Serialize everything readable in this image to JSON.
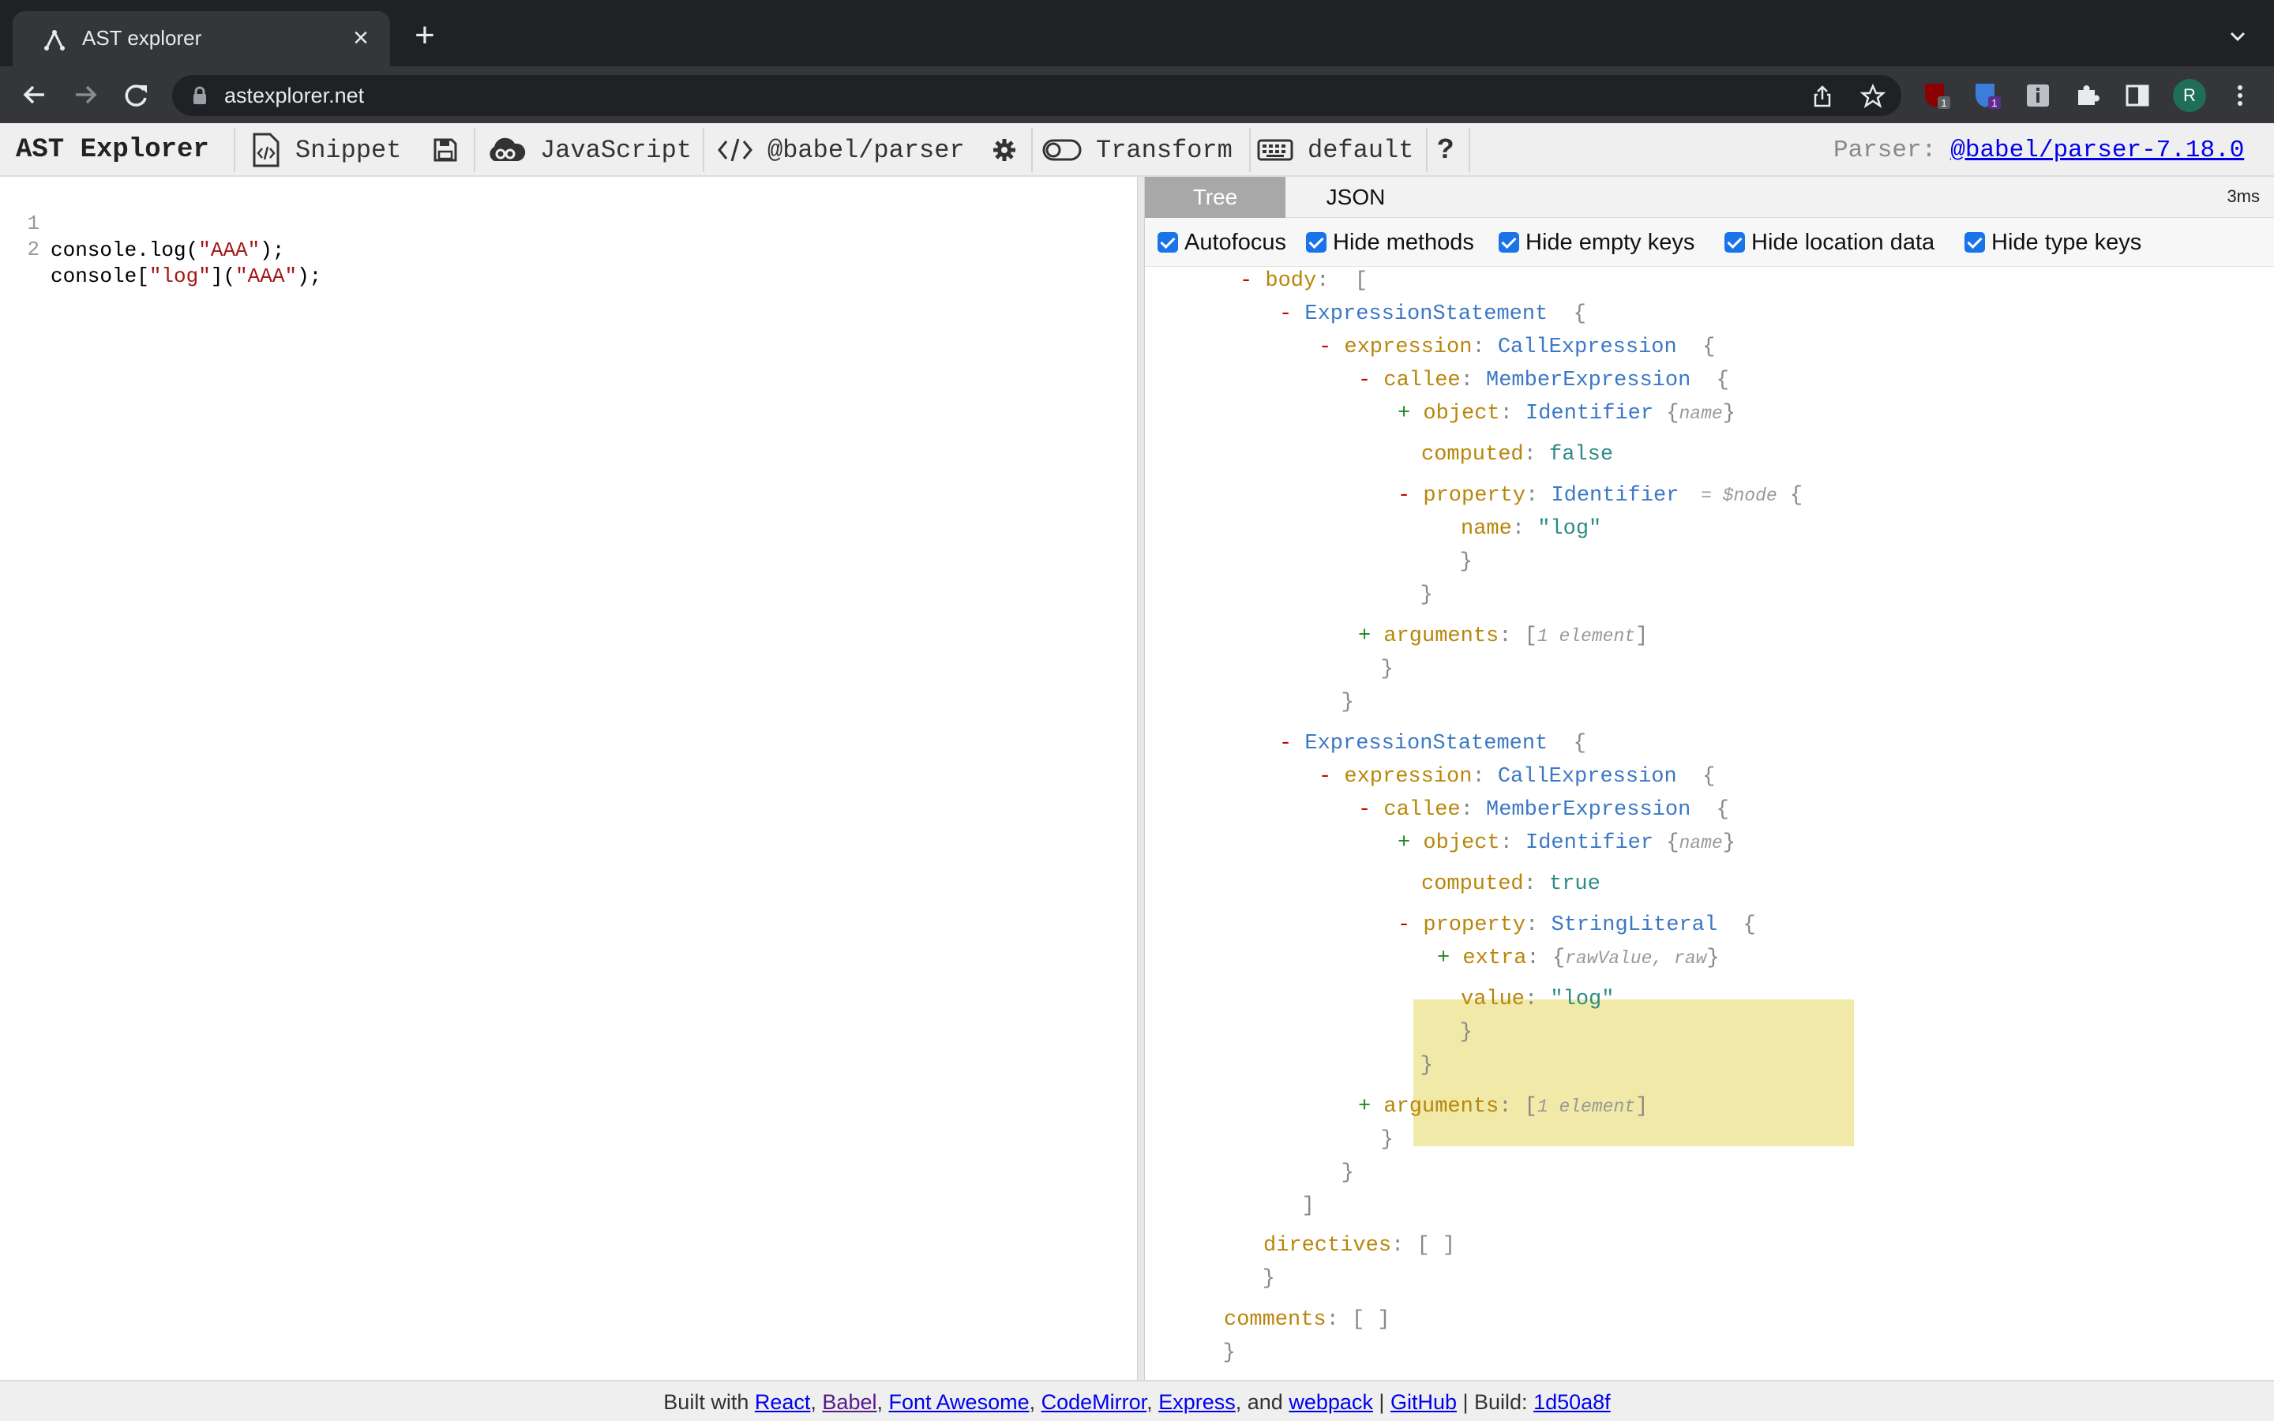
{
  "browser": {
    "tab_title": "AST explorer",
    "url": "astexplorer.net",
    "profile_initial": "R",
    "ext_badge_1": "1",
    "ext_badge_2": "1"
  },
  "toolbar": {
    "brand": "AST Explorer",
    "snippet": "Snippet",
    "language": "JavaScript",
    "parser": "@babel/parser",
    "transform": "Transform",
    "keymap": "default",
    "help": "?",
    "parser_label": "Parser:",
    "parser_version": "@babel/parser-7.18.0"
  },
  "editor": {
    "lines": [
      {
        "num": "1",
        "pre": "console.log(",
        "str": "\"AAA\"",
        "post": ");"
      },
      {
        "num": "2",
        "pre": "console[",
        "str": "\"log\"",
        "mid": "](",
        "str2": "\"AAA\"",
        "post": ");"
      }
    ]
  },
  "output": {
    "tab_tree": "Tree",
    "tab_json": "JSON",
    "timing": "3ms",
    "options": [
      "Autofocus",
      "Hide methods",
      "Hide empty keys",
      "Hide location data",
      "Hide type keys"
    ],
    "tree": {
      "body": "body",
      "expr_stmt": "ExpressionStatement",
      "expression": "expression",
      "call_expr": "CallExpression",
      "callee": "callee",
      "member_expr": "MemberExpression",
      "object": "object",
      "identifier": "Identifier",
      "name_hint": "name",
      "computed": "computed",
      "false": "false",
      "true": "true",
      "property": "property",
      "node_hint": "= $node",
      "name": "name",
      "log_str": "\"log\"",
      "arguments": "arguments",
      "args_hint": "1 element",
      "string_literal": "StringLiteral",
      "extra": "extra",
      "extra_hint": "rawValue, raw",
      "value": "value",
      "directives": "directives",
      "comments": "comments"
    }
  },
  "footer": {
    "built_with": "Built with",
    "links": [
      "React",
      "Babel",
      "Font Awesome",
      "CodeMirror",
      "Express",
      "webpack",
      "GitHub",
      "1d50a8f"
    ],
    "and": "and",
    "build": "Build:"
  },
  "colors": {
    "chrome_dark": "#202124",
    "chrome_tab": "#35363a",
    "highlight": "#f0e9a8",
    "key": "#b8860b",
    "type": "#3b78c4",
    "checkbox": "#1a73e8"
  },
  "icons": [
    "app-favicon-icon",
    "close-icon",
    "plus-icon",
    "chevron-down-icon",
    "back-arrow-icon",
    "forward-arrow-icon",
    "reload-icon",
    "lock-icon",
    "share-icon",
    "star-icon",
    "ublock-extension-icon",
    "bitwarden-extension-icon",
    "info-extension-icon",
    "puzzle-icon",
    "sidepanel-icon",
    "kebab-menu-icon",
    "code-file-icon",
    "save-icon",
    "cloud-icon",
    "code-brackets-icon",
    "gear-icon",
    "toggle-icon",
    "keyboard-icon",
    "question-icon"
  ]
}
